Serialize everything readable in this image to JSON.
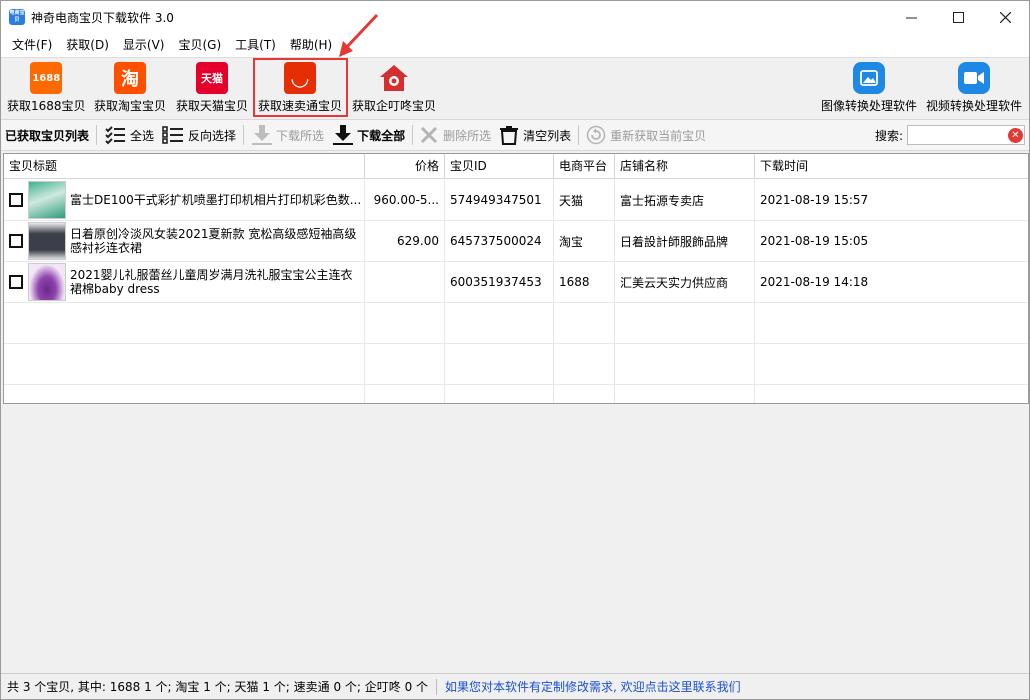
{
  "window": {
    "title": "神奇电商宝贝下载软件 3.0",
    "app_icon_text": "电商宝贝"
  },
  "menu": [
    "文件(F)",
    "获取(D)",
    "显示(V)",
    "宝贝(G)",
    "工具(T)",
    "帮助(H)"
  ],
  "toolbar_main": {
    "btn_1688": {
      "label": "获取1688宝贝",
      "icon_text": "1688",
      "icon": "1688-icon",
      "color": "#ff6a00"
    },
    "btn_taobao": {
      "label": "获取淘宝宝贝",
      "icon_text": "淘",
      "icon": "taobao-icon",
      "color": "#ff5000"
    },
    "btn_tmall": {
      "label": "获取天猫宝贝",
      "icon_text": "天猫",
      "icon": "tmall-icon",
      "color": "#e4002b"
    },
    "btn_aliexpress": {
      "label": "获取速卖通宝贝",
      "icon_text": "◡",
      "icon": "aliexpress-icon",
      "color": "#e62e04"
    },
    "btn_qidingdong": {
      "label": "获取企叮咚宝贝",
      "icon": "qidingdong-icon",
      "color": "#d32f2f"
    },
    "btn_image": {
      "label": "图像转换处理软件",
      "icon": "image-convert-icon",
      "color": "#1e88e5"
    },
    "btn_video": {
      "label": "视频转换处理软件",
      "icon": "video-convert-icon",
      "color": "#1e88e5"
    }
  },
  "toolbar_list": {
    "list_label": "已获取宝贝列表",
    "select_all": "全选",
    "invert": "反向选择",
    "download_selected": "下载所选",
    "download_all": "下载全部",
    "delete_selected": "删除所选",
    "clear_list": "清空列表",
    "refetch": "重新获取当前宝贝",
    "search_label": "搜索:",
    "search_value": ""
  },
  "table": {
    "headers": [
      "宝贝标题",
      "价格",
      "宝贝ID",
      "电商平台",
      "店铺名称",
      "下载时间"
    ],
    "rows": [
      {
        "title": "富士DE100干式彩扩机喷墨打印机相片打印机彩色数...",
        "price": "960.00-5...",
        "id": "574949347501",
        "platform": "天猫",
        "shop": "富士拓源专卖店",
        "time": "2021-08-19 15:57"
      },
      {
        "title": "日着原创冷淡风女装2021夏新款 宽松高级感短袖高级感衬衫连衣裙",
        "price": "629.00",
        "id": "645737500024",
        "platform": "淘宝",
        "shop": "日着設計師服飾品牌",
        "time": "2021-08-19 15:05"
      },
      {
        "title": "2021婴儿礼服蕾丝儿童周岁满月洗礼服宝宝公主连衣裙棉baby dress",
        "price": "",
        "id": "600351937453",
        "platform": "1688",
        "shop": "汇美云天实力供应商",
        "time": "2021-08-19 14:18"
      }
    ]
  },
  "status": {
    "summary": "共 3 个宝贝, 其中: 1688 1 个; 淘宝 1 个; 天猫 1 个; 速卖通 0 个; 企叮咚 0 个",
    "link": "如果您对本软件有定制修改需求, 欢迎点击这里联系我们"
  },
  "colors": {
    "highlight": "#e53935",
    "link": "#1a4fd1"
  }
}
